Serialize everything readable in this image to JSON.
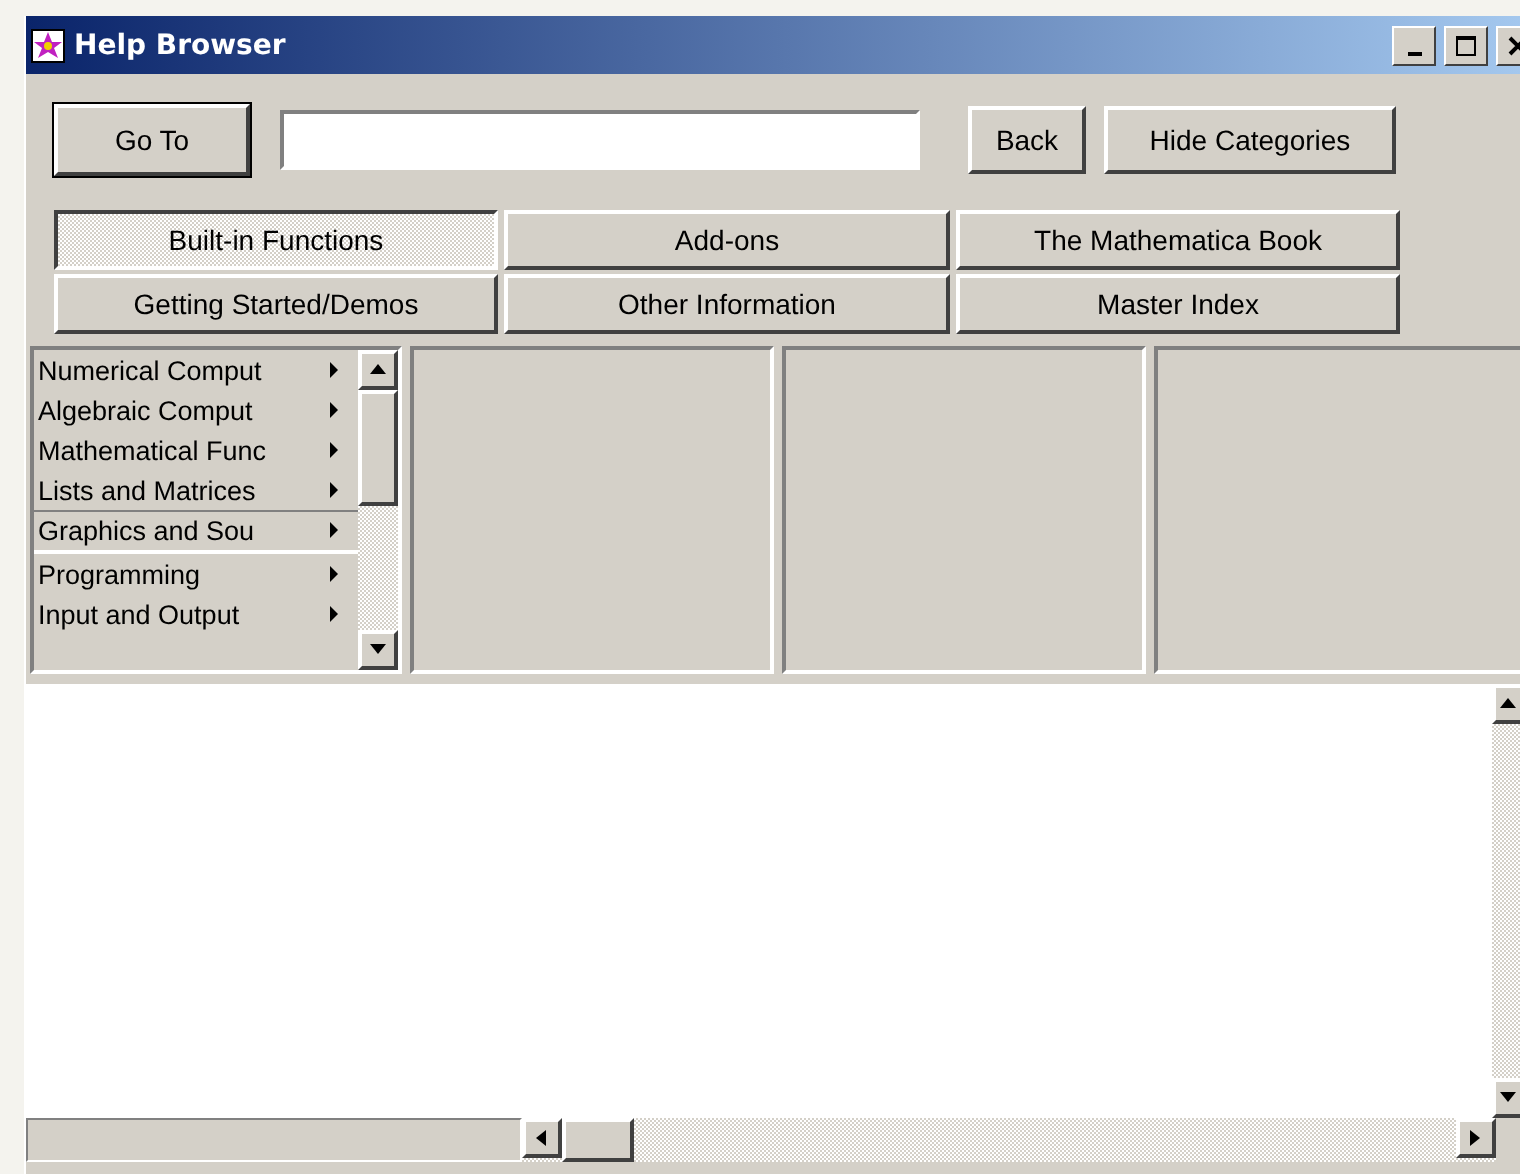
{
  "window": {
    "title": "Help Browser"
  },
  "toolbar": {
    "goto_button": "Go To",
    "back_button": "Back",
    "hide_button": "Hide Categories"
  },
  "categories": [
    {
      "label": "Built-in Functions",
      "selected": true
    },
    {
      "label": "Add-ons",
      "selected": false
    },
    {
      "label": "The Mathematica Book",
      "selected": false
    },
    {
      "label": "Getting Started/Demos",
      "selected": false
    },
    {
      "label": "Other Information",
      "selected": false
    },
    {
      "label": "Master Index",
      "selected": false
    }
  ],
  "topics": [
    {
      "label": "Numerical Comput"
    },
    {
      "label": "Algebraic Comput"
    },
    {
      "label": "Mathematical Func"
    },
    {
      "label": "Lists and Matrices"
    },
    {
      "label": "Graphics and Sou",
      "separator_after": true
    },
    {
      "label": "Programming"
    },
    {
      "label": "Input and Output"
    }
  ]
}
